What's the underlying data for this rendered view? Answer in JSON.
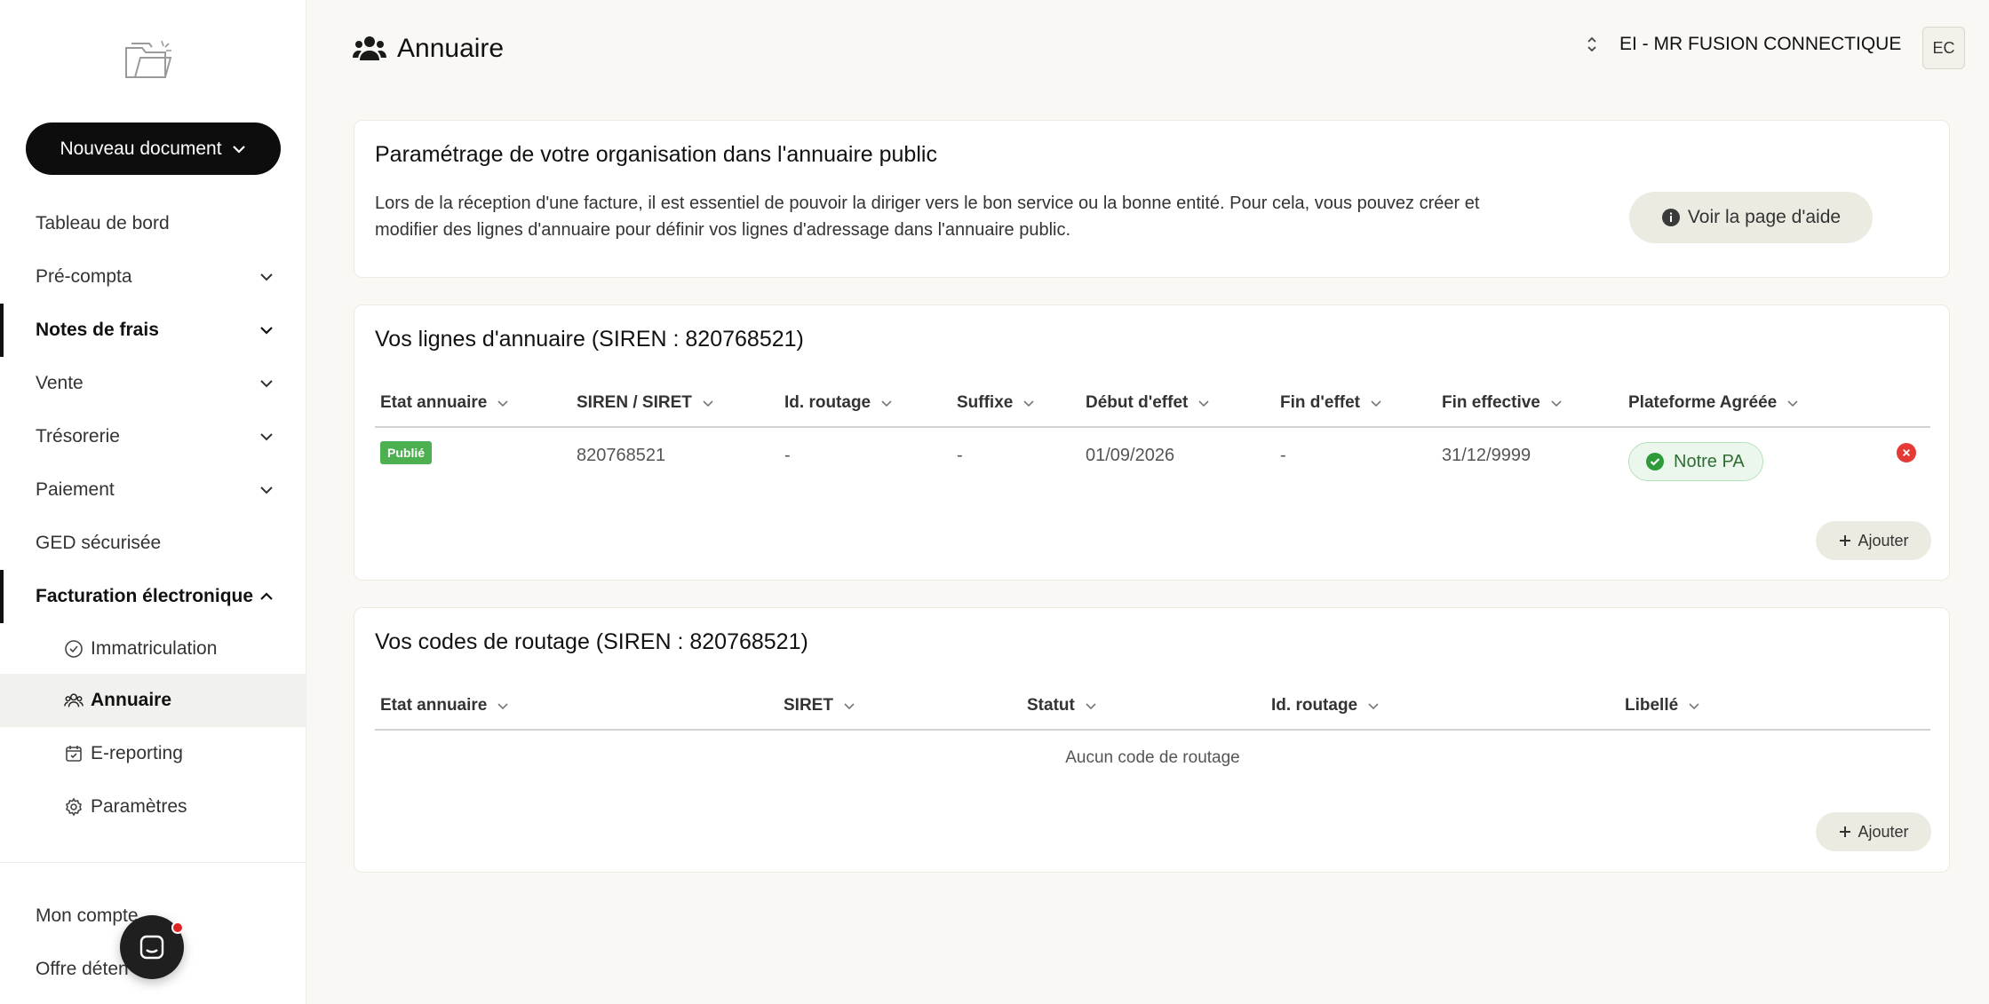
{
  "sidebar": {
    "new_document_label": "Nouveau document",
    "items": [
      {
        "label": "Tableau de bord"
      },
      {
        "label": "Pré-compta"
      },
      {
        "label": "Notes de frais"
      },
      {
        "label": "Vente"
      },
      {
        "label": "Trésorerie"
      },
      {
        "label": "Paiement"
      },
      {
        "label": "GED sécurisée"
      },
      {
        "label": "Facturation électronique"
      }
    ],
    "subitems": [
      {
        "label": "Immatriculation"
      },
      {
        "label": "Annuaire"
      },
      {
        "label": "E-reporting"
      },
      {
        "label": "Paramètres"
      }
    ],
    "bottom": {
      "account": "Mon compte",
      "offer": "Offre déten"
    }
  },
  "header": {
    "title": "Annuaire",
    "organization": "EI - MR FUSION CONNECTIQUE",
    "avatar_initials": "EC"
  },
  "settings_card": {
    "title": "Paramétrage de votre organisation dans l'annuaire public",
    "description": "Lors de la réception d'une facture, il est essentiel de pouvoir la diriger vers le bon service ou la bonne entité. Pour cela, vous pouvez créer et modifier des lignes d'annuaire pour définir vos lignes d'adressage dans l'annuaire public.",
    "help_button": "Voir la page d'aide"
  },
  "directory_lines": {
    "title": "Vos lignes d'annuaire (SIREN : 820768521)",
    "columns": [
      "Etat annuaire",
      "SIREN / SIRET",
      "Id. routage",
      "Suffixe",
      "Début d'effet",
      "Fin d'effet",
      "Fin effective",
      "Plateforme Agréée"
    ],
    "rows": [
      {
        "status": "Publié",
        "siren_siret": "820768521",
        "routing_id": "-",
        "suffix": "-",
        "start": "01/09/2026",
        "end": "-",
        "effective_end": "31/12/9999",
        "platform": "Notre PA"
      }
    ],
    "add_button": "Ajouter"
  },
  "routing_codes": {
    "title": "Vos codes de routage (SIREN : 820768521)",
    "columns": [
      "Etat annuaire",
      "SIRET",
      "Statut",
      "Id. routage",
      "Libellé"
    ],
    "empty_message": "Aucun code de routage",
    "add_button": "Ajouter"
  },
  "colors": {
    "published_badge": "#4caf50",
    "platform_chip_bg": "#ebf7ec",
    "delete_icon": "#e53935",
    "primary_button": "#0d0d0d"
  }
}
